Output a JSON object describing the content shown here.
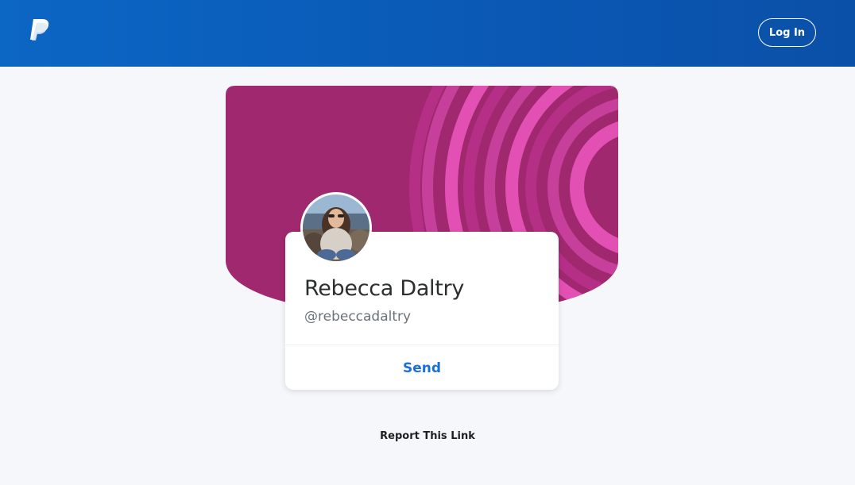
{
  "header": {
    "logo_icon": "paypal-logo-icon",
    "login_label": "Log In",
    "background_color": "#0b5fbf"
  },
  "profile": {
    "name": "Rebecca Daltry",
    "handle": "@rebeccadaltry",
    "avatar_icon": "profile-photo",
    "send_label": "Send",
    "accent_color": "#1a6fd8"
  },
  "hero": {
    "base_color": "#a0286f",
    "ring_colors": [
      "#b62f86",
      "#c6409b",
      "#e350b3"
    ]
  },
  "footer": {
    "report_label": "Report This Link"
  }
}
